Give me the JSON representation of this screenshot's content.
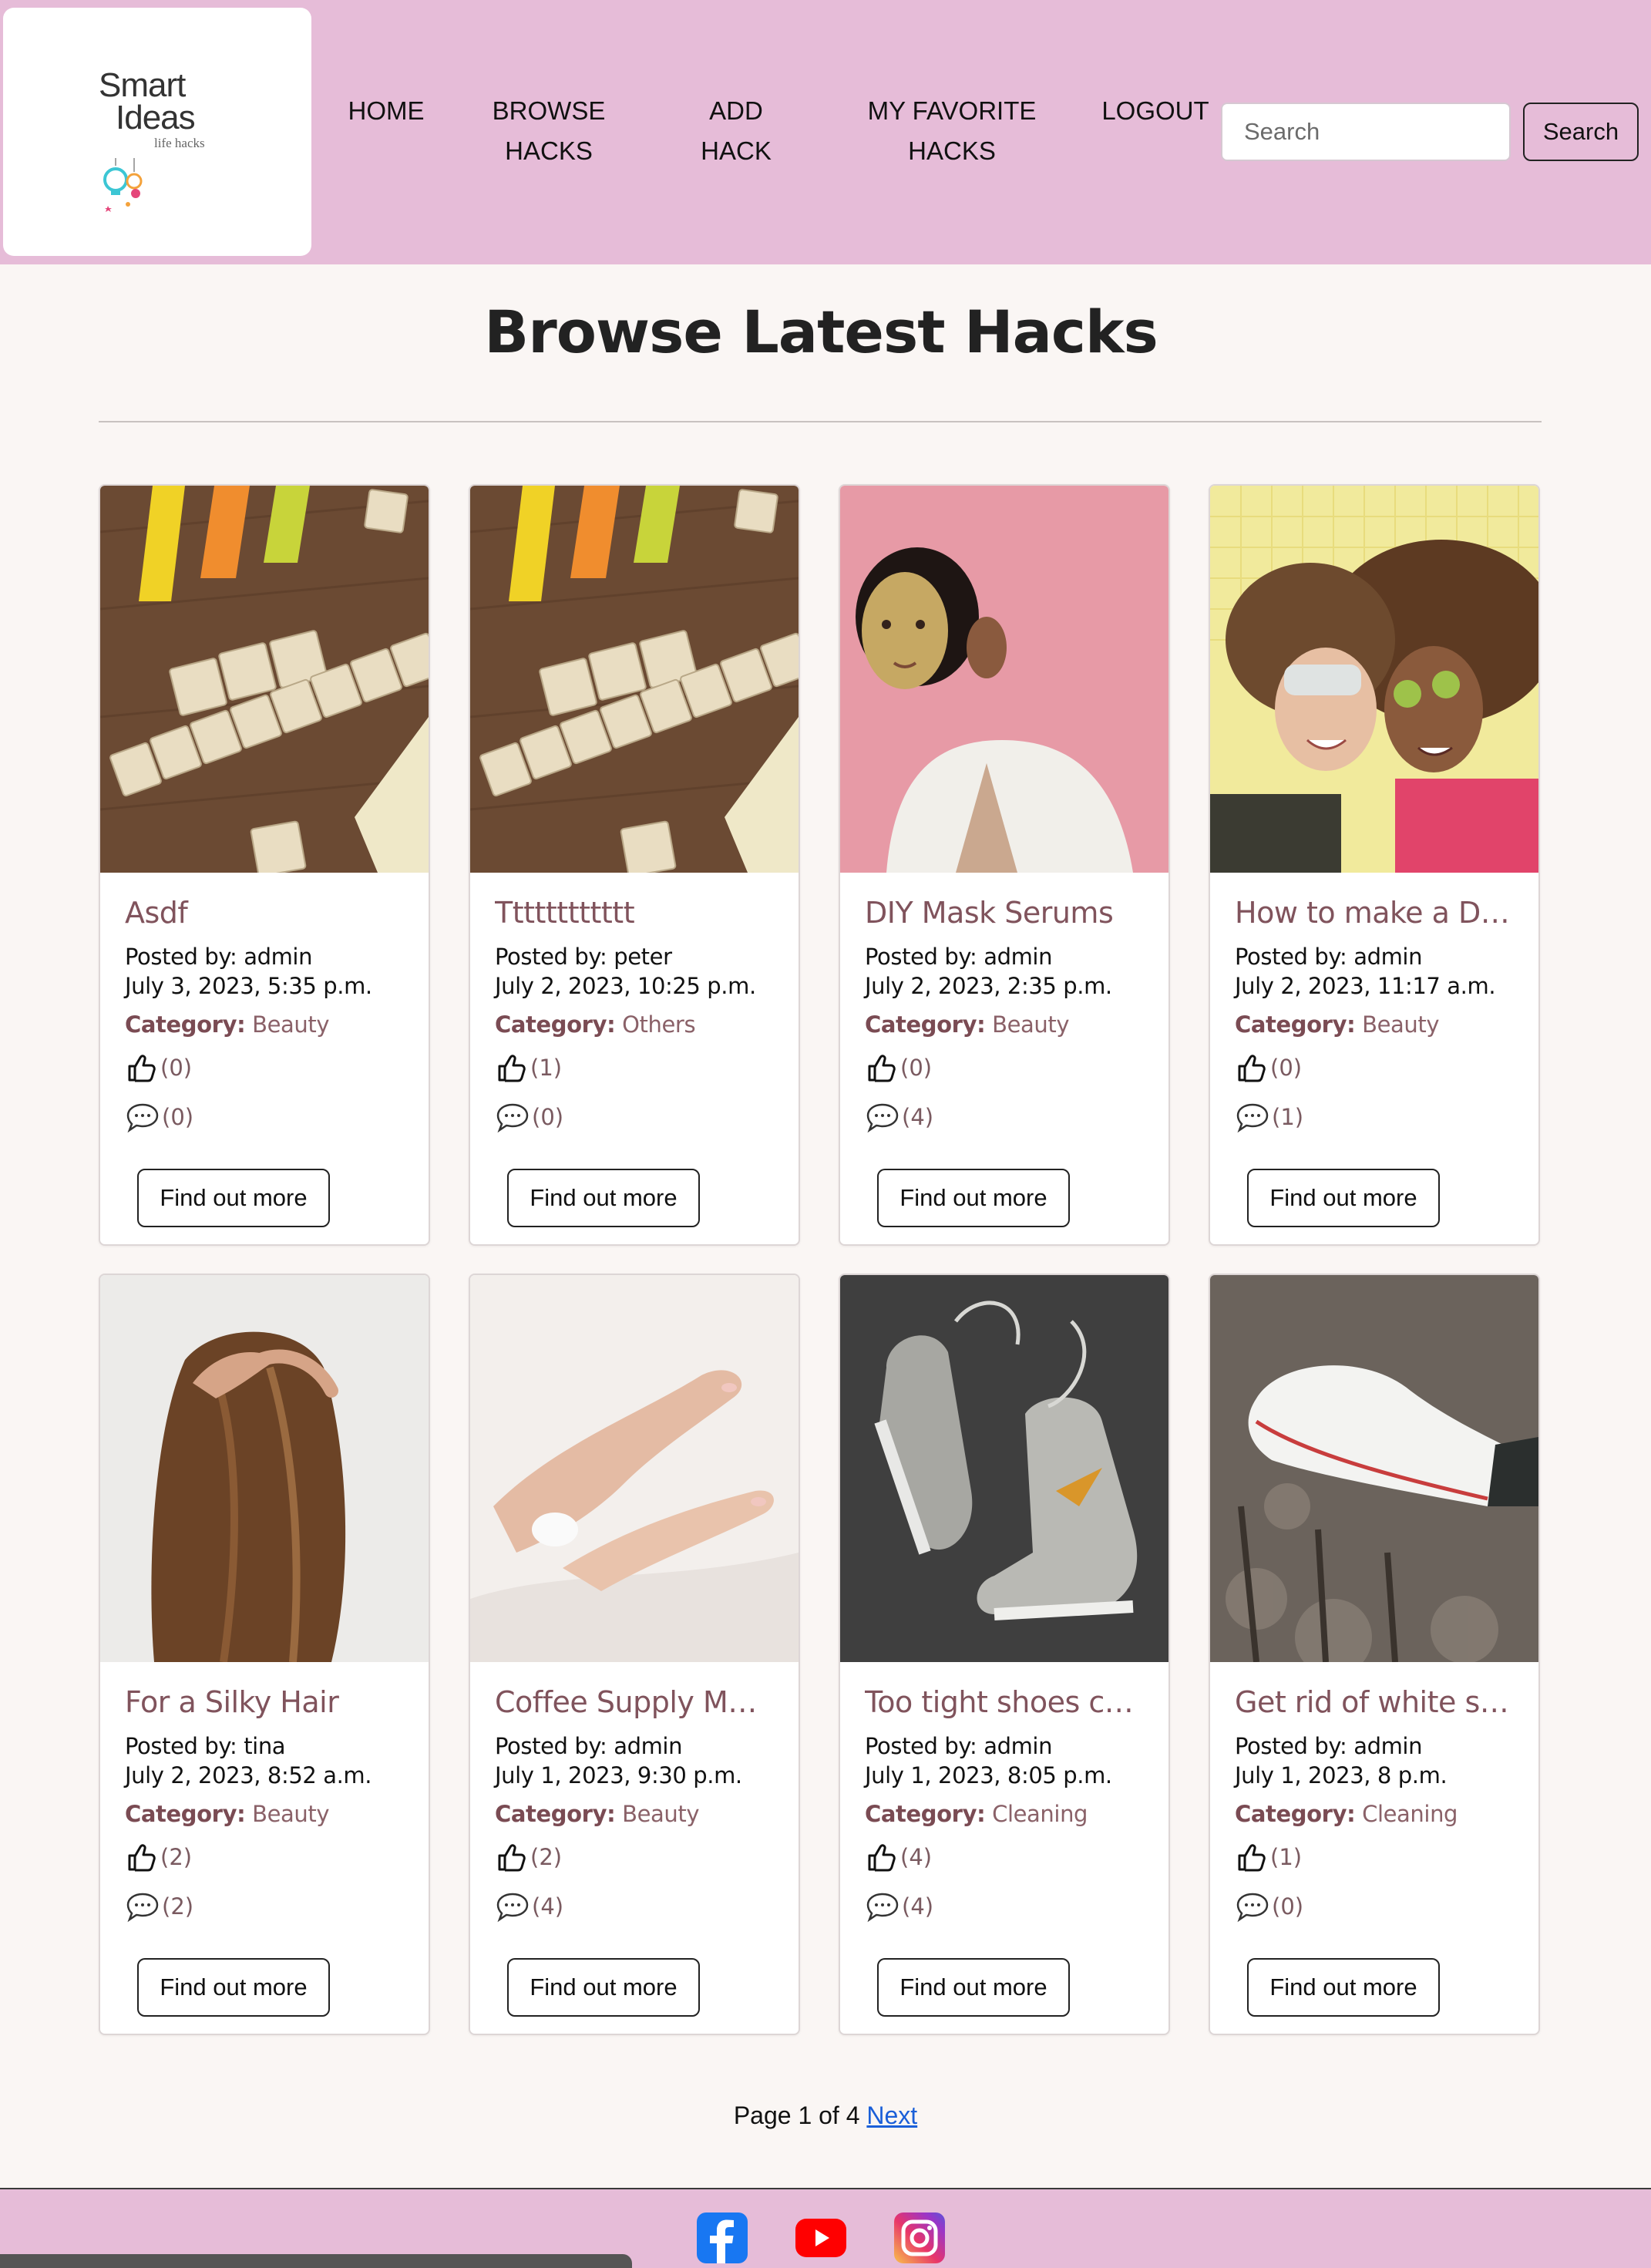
{
  "header": {
    "logo": {
      "line1": "Smart",
      "line2": "Ideas",
      "tagline": "life hacks"
    },
    "nav": [
      {
        "label": "HOME"
      },
      {
        "label": "BROWSE HACKS"
      },
      {
        "label": "ADD HACK"
      },
      {
        "label": "MY FAVORITE HACKS"
      },
      {
        "label": "LOGOUT"
      }
    ],
    "search": {
      "placeholder": "Search",
      "value": "",
      "button_label": "Search"
    }
  },
  "main": {
    "title": "Browse Latest Hacks",
    "posted_by_prefix": "Posted by: ",
    "category_prefix": "Category:",
    "button_label": "Find out more",
    "cards": [
      {
        "title": "Asdf",
        "author": "admin",
        "date": "July 3, 2023, 5:35 p.m.",
        "category": "Beauty",
        "likes": "(0)",
        "comments": "(0)",
        "image": "life-hacking-scrabble"
      },
      {
        "title": "Tttttttttttt",
        "author": "peter",
        "date": "July 2, 2023, 10:25 p.m.",
        "category": "Others",
        "likes": "(1)",
        "comments": "(0)",
        "image": "life-hacking-scrabble"
      },
      {
        "title": "DIY Mask Serums",
        "author": "admin",
        "date": "July 2, 2023, 2:35 p.m.",
        "category": "Beauty",
        "likes": "(0)",
        "comments": "(4)",
        "image": "woman-face-mask"
      },
      {
        "title": "How to make a DIY…",
        "author": "admin",
        "date": "July 2, 2023, 11:17 a.m.",
        "category": "Beauty",
        "likes": "(0)",
        "comments": "(1)",
        "image": "women-eye-masks"
      },
      {
        "title": "For a Silky Hair",
        "author": "tina",
        "date": "July 2, 2023, 8:52 a.m.",
        "category": "Beauty",
        "likes": "(2)",
        "comments": "(2)",
        "image": "long-hair"
      },
      {
        "title": "Coffee Supply Man…",
        "author": "admin",
        "date": "July 1, 2023, 9:30 p.m.",
        "category": "Beauty",
        "likes": "(2)",
        "comments": "(4)",
        "image": "hands-nails"
      },
      {
        "title": "Too tight shoes cau…",
        "author": "admin",
        "date": "July 1, 2023, 8:05 p.m.",
        "category": "Cleaning",
        "likes": "(4)",
        "comments": "(4)",
        "image": "sneakers"
      },
      {
        "title": "Get rid of white sn…",
        "author": "admin",
        "date": "July 1, 2023, 8 p.m.",
        "category": "Cleaning",
        "likes": "(1)",
        "comments": "(0)",
        "image": "white-sneaker"
      }
    ]
  },
  "pagination": {
    "text": "Page 1 of 4",
    "next_label": "Next"
  },
  "footer": {
    "icons": [
      "facebook-icon",
      "youtube-icon",
      "instagram-icon"
    ]
  },
  "colors": {
    "header_bg": "#e6bcd8",
    "title_accent": "#80535c",
    "link": "#1a5fd8"
  }
}
